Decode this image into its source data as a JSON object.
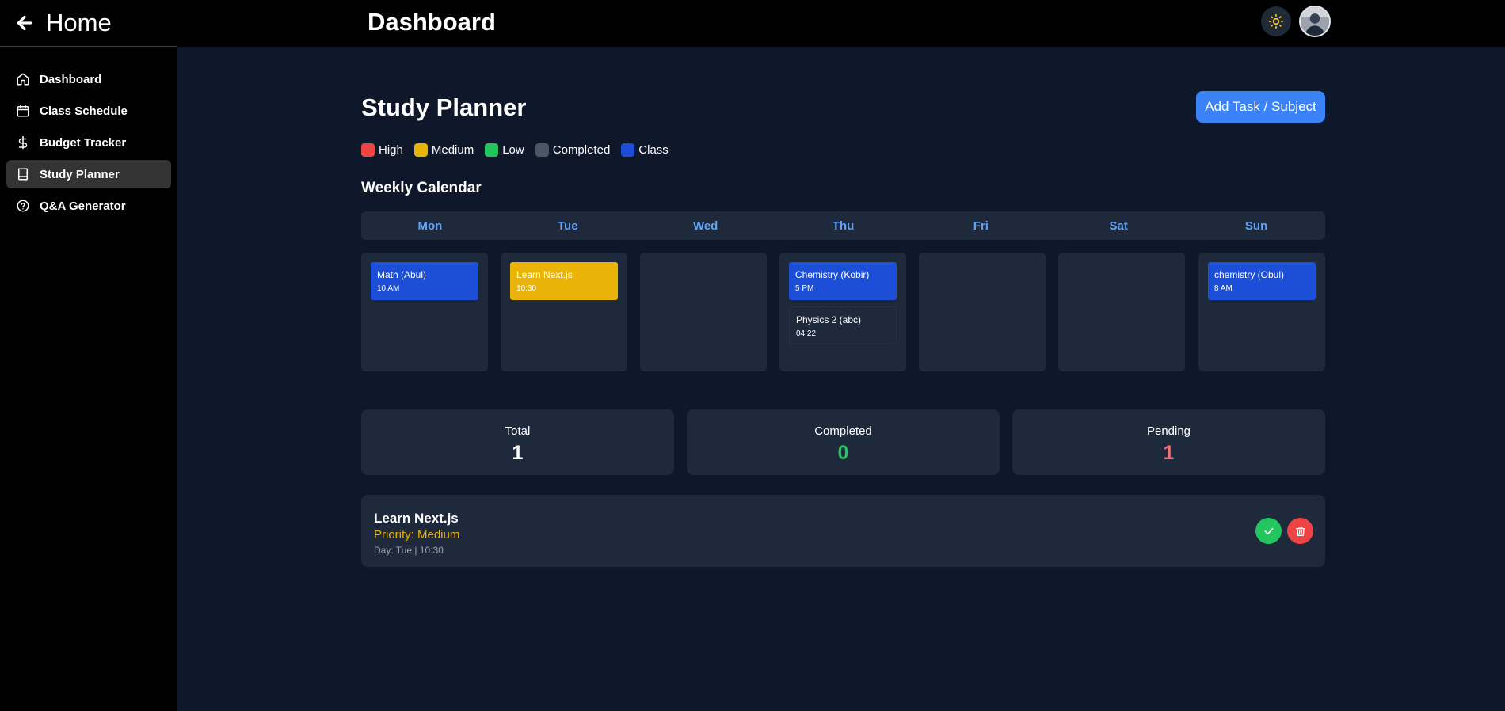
{
  "header": {
    "home_label": "Home",
    "title": "Dashboard",
    "theme_icon": "sun-icon",
    "avatar_icon": "user-avatar"
  },
  "sidebar": {
    "items": [
      {
        "label": "Dashboard",
        "icon": "home-icon",
        "active": false
      },
      {
        "label": "Class Schedule",
        "icon": "calendar-icon",
        "active": false
      },
      {
        "label": "Budget Tracker",
        "icon": "dollar-icon",
        "active": false
      },
      {
        "label": "Study Planner",
        "icon": "book-icon",
        "active": true
      },
      {
        "label": "Q&A Generator",
        "icon": "help-circle-icon",
        "active": false
      }
    ]
  },
  "page": {
    "title": "Study Planner",
    "add_button": "Add Task / Subject"
  },
  "legend": [
    {
      "label": "High",
      "color": "#ef4444"
    },
    {
      "label": "Medium",
      "color": "#eab308"
    },
    {
      "label": "Low",
      "color": "#22c55e"
    },
    {
      "label": "Completed",
      "color": "#4b5563"
    },
    {
      "label": "Class",
      "color": "#1d4ed8"
    }
  ],
  "calendar": {
    "title": "Weekly Calendar",
    "days": [
      "Mon",
      "Tue",
      "Wed",
      "Thu",
      "Fri",
      "Sat",
      "Sun"
    ],
    "events": {
      "mon": [
        {
          "title": "Math (Abul)",
          "time": "10 AM",
          "kind": "class"
        }
      ],
      "tue": [
        {
          "title": "Learn Next.js",
          "time": "10:30",
          "kind": "medium"
        }
      ],
      "wed": [],
      "thu": [
        {
          "title": "Chemistry (Kobir)",
          "time": "5 PM",
          "kind": "class"
        },
        {
          "title": "Physics 2 (abc)",
          "time": "04:22",
          "kind": "plain"
        }
      ],
      "fri": [],
      "sat": [],
      "sun": [
        {
          "title": "chemistry (Obul)",
          "time": "8 AM",
          "kind": "class"
        }
      ]
    }
  },
  "stats": {
    "total_label": "Total",
    "total_value": "1",
    "completed_label": "Completed",
    "completed_value": "0",
    "pending_label": "Pending",
    "pending_value": "1",
    "completed_color": "#22c55e",
    "pending_color": "#f87171"
  },
  "task": {
    "title": "Learn Next.js",
    "priority": "Priority: Medium",
    "day": "Day: Tue | 10:30",
    "complete_icon": "check-icon",
    "delete_icon": "trash-icon"
  }
}
